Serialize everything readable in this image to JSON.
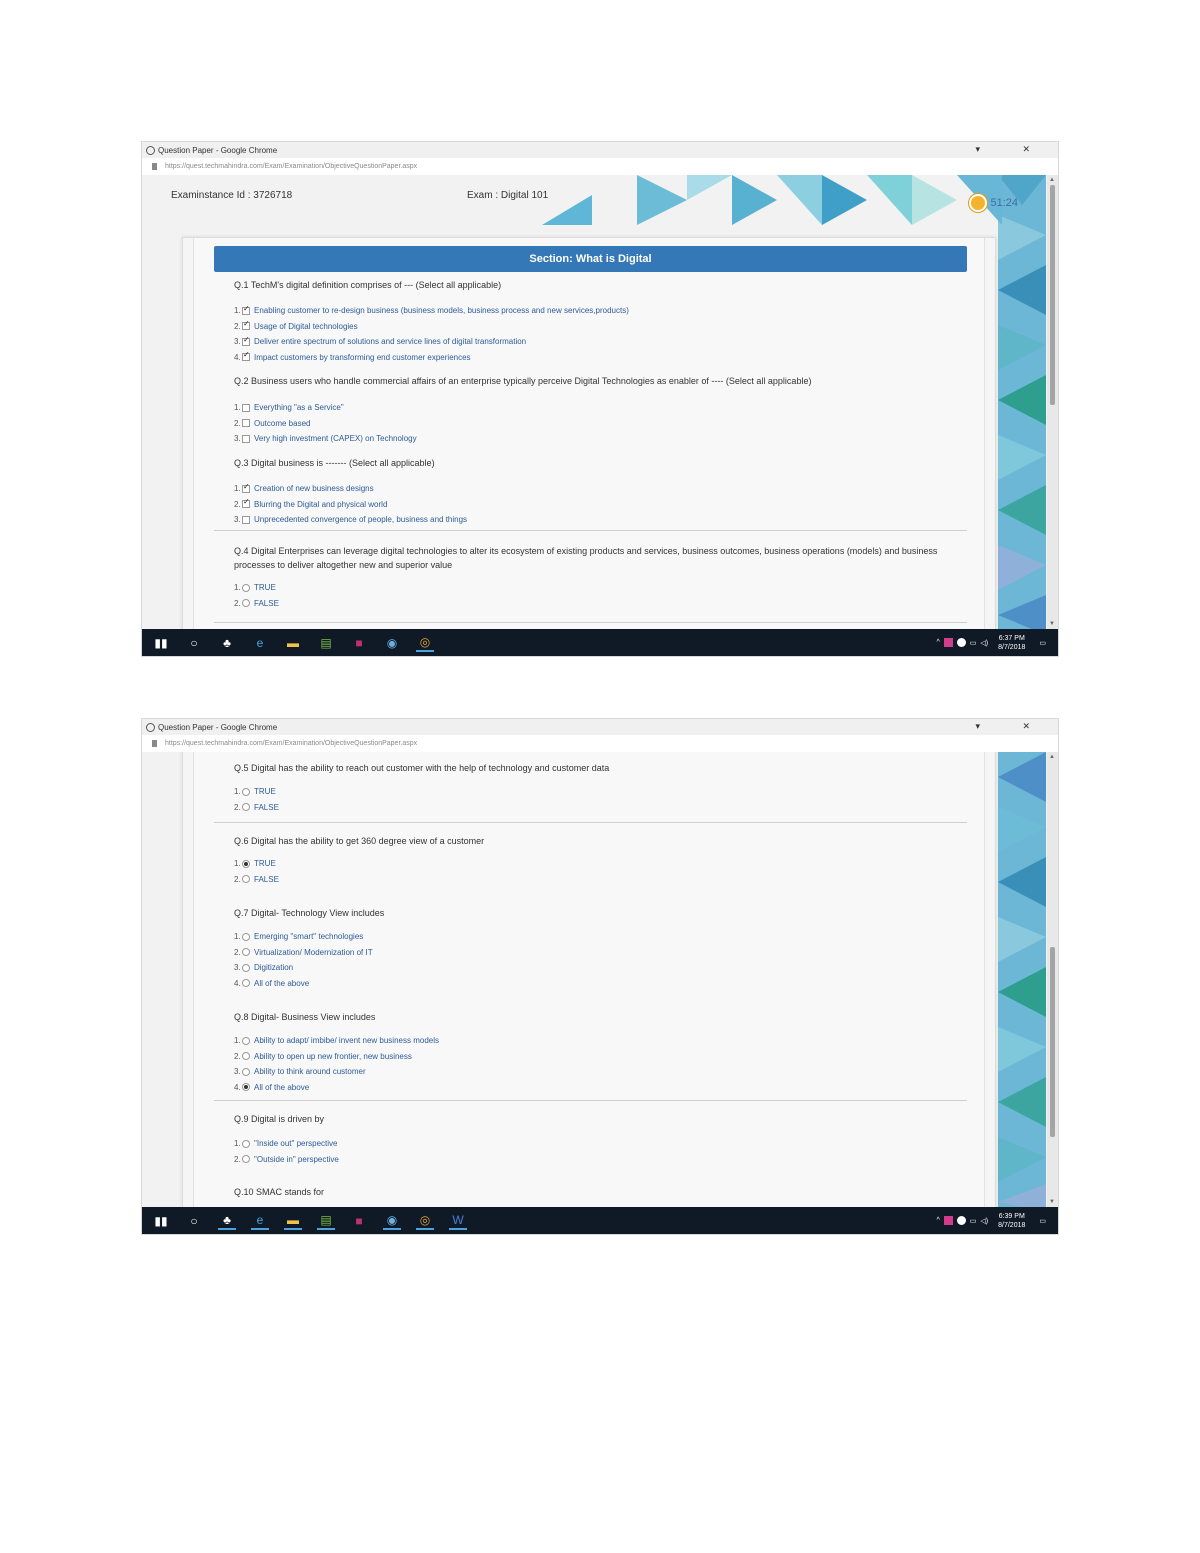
{
  "browser": {
    "window_title": "Question Paper - Google Chrome",
    "url": "https://quest.techmahindra.com/Exam/Examination/ObjectiveQuestionPaper.aspx"
  },
  "screenshot1": {
    "header": {
      "examinstance_label": "Examinstance Id : 3726718",
      "exam_label": "Exam : Digital 101",
      "timer": "51:24"
    },
    "section_title": "Section: What is Digital",
    "questions": [
      {
        "text": "Q.1 TechM's digital definition comprises of --- (Select all applicable)",
        "type": "checkbox",
        "options": [
          {
            "num": "1.",
            "label": "Enabling customer to re-design business (business models, business process and new services,products)",
            "selected": true
          },
          {
            "num": "2.",
            "label": "Usage of Digital technologies",
            "selected": true
          },
          {
            "num": "3.",
            "label": "Deliver entire spectrum of solutions and service lines of digital transformation",
            "selected": true
          },
          {
            "num": "4.",
            "label": "Impact customers by transforming end customer experiences",
            "selected": true
          }
        ]
      },
      {
        "text": "Q.2 Business users who handle commercial affairs of an enterprise typically perceive Digital Technologies as enabler of ---- (Select all applicable)",
        "type": "checkbox",
        "options": [
          {
            "num": "1.",
            "label": "Everything \"as a Service\"",
            "selected": false
          },
          {
            "num": "2.",
            "label": "Outcome based",
            "selected": false
          },
          {
            "num": "3.",
            "label": "Very high investment (CAPEX) on Technology",
            "selected": false
          }
        ]
      },
      {
        "text": "Q.3 Digital business is ------- (Select all applicable)",
        "type": "checkbox",
        "options": [
          {
            "num": "1.",
            "label": "Creation of new business designs",
            "selected": true
          },
          {
            "num": "2.",
            "label": "Blurring the Digital and physical world",
            "selected": true
          },
          {
            "num": "3.",
            "label": "Unprecedented convergence of people, business and things",
            "selected": false
          }
        ]
      },
      {
        "text": "Q.4 Digital Enterprises can leverage digital technologies to alter its ecosystem of existing products and services, business outcomes, business operations (models) and business processes to deliver altogether new and superior value",
        "type": "radio",
        "options": [
          {
            "num": "1.",
            "label": "TRUE",
            "selected": false
          },
          {
            "num": "2.",
            "label": "FALSE",
            "selected": false
          }
        ]
      }
    ]
  },
  "screenshot2": {
    "questions": [
      {
        "text": "Q.5 Digital has the ability to reach out customer with the help of technology and customer data",
        "type": "radio",
        "options": [
          {
            "num": "1.",
            "label": "TRUE",
            "selected": false
          },
          {
            "num": "2.",
            "label": "FALSE",
            "selected": false
          }
        ]
      },
      {
        "text": "Q.6 Digital has the ability to get 360 degree view of a customer",
        "type": "radio",
        "options": [
          {
            "num": "1.",
            "label": "TRUE",
            "selected": true
          },
          {
            "num": "2.",
            "label": "FALSE",
            "selected": false
          }
        ]
      },
      {
        "text": "Q.7 Digital- Technology View includes",
        "type": "radio",
        "options": [
          {
            "num": "1.",
            "label": "Emerging \"smart\" technologies",
            "selected": false
          },
          {
            "num": "2.",
            "label": "Virtualization/ Modernization of IT",
            "selected": false
          },
          {
            "num": "3.",
            "label": "Digitization",
            "selected": false
          },
          {
            "num": "4.",
            "label": "All of the above",
            "selected": false
          }
        ]
      },
      {
        "text": "Q.8 Digital- Business View includes",
        "type": "radio",
        "options": [
          {
            "num": "1.",
            "label": "Ability to adapt/ imbibe/ invent new business models",
            "selected": false
          },
          {
            "num": "2.",
            "label": "Ability to open up new frontier, new business",
            "selected": false
          },
          {
            "num": "3.",
            "label": "Ability to think around customer",
            "selected": false
          },
          {
            "num": "4.",
            "label": "All of the above",
            "selected": true
          }
        ]
      },
      {
        "text": "Q.9 Digital is driven by",
        "type": "radio",
        "options": [
          {
            "num": "1.",
            "label": "\"Inside out\" perspective",
            "selected": false
          },
          {
            "num": "2.",
            "label": "\"Outside in\" perspective",
            "selected": false
          }
        ]
      },
      {
        "text": "Q.10 SMAC stands for",
        "type": "radio",
        "options": []
      }
    ]
  },
  "taskbar": {
    "clock1": {
      "time": "6:37 PM",
      "date": "8/7/2018"
    },
    "clock2": {
      "time": "6:39 PM",
      "date": "8/7/2018"
    },
    "icons": [
      "windows-start-icon",
      "cortana-search-icon",
      "file-manager-icon",
      "edge-browser-icon",
      "file-explorer-icon",
      "notepad-icon",
      "media-app-icon",
      "globe-app-icon",
      "chrome-icon",
      "word-icon"
    ]
  },
  "colors": {
    "section_bar": "#3578b8",
    "option_text": "#2d5b97",
    "taskbar": "#0f1a26",
    "timer_clock": "#f5b22b"
  }
}
